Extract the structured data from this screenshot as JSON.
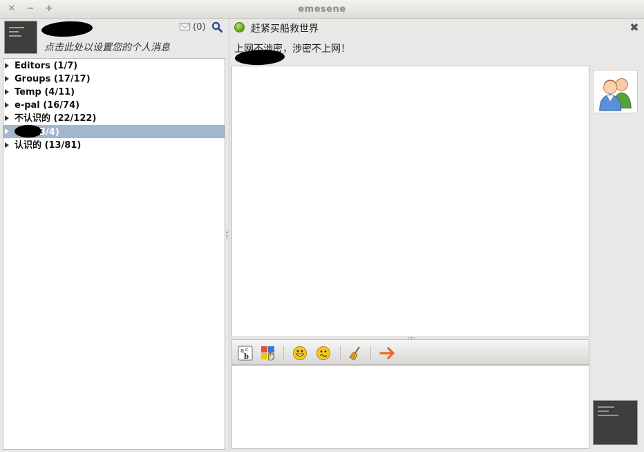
{
  "window": {
    "title": "emesene",
    "controls": [
      "close-icon",
      "minimize-icon",
      "maximize-icon"
    ]
  },
  "self": {
    "mail_count": "(0)",
    "personal_message": "点击此处以设置您的个人消息"
  },
  "groups": [
    {
      "label": "Editors (1/7)"
    },
    {
      "label": "Groups (17/17)"
    },
    {
      "label": "Temp (4/11)"
    },
    {
      "label": "e-pal (16/74)"
    },
    {
      "label": "不认识的 (22/122)"
    },
    {
      "label": "3/4)",
      "selected": true
    },
    {
      "label": "认识的 (13/81)"
    }
  ],
  "conversation": {
    "partner_nick": "赶紧买船救世界",
    "partner_message": "上网不涉密，涉密不上网！",
    "status_color": "#6aa626"
  },
  "toolbar": {
    "buttons": [
      "font-icon",
      "color-icon",
      "emoticon-icon",
      "wink-icon",
      "clean-icon",
      "nudge-icon"
    ]
  },
  "colors": {
    "selection": "#a3b6cc",
    "background": "#e9e8e6"
  }
}
